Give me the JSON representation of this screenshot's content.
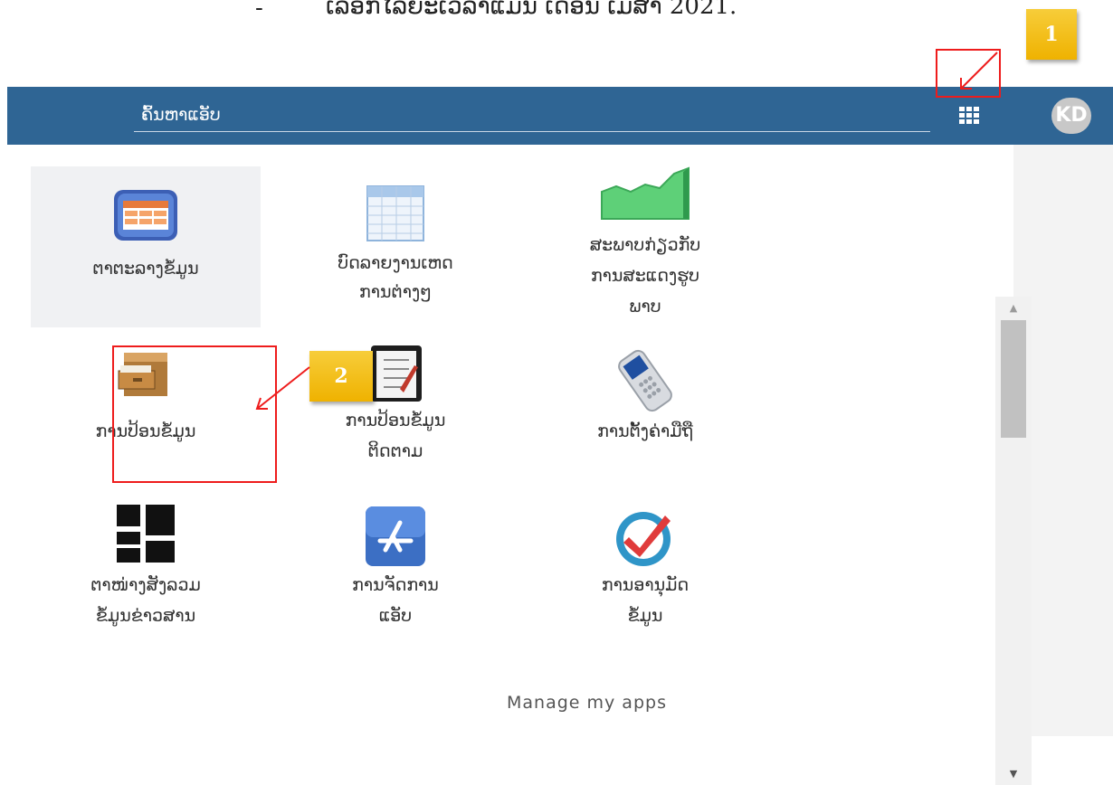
{
  "document_text": {
    "bullet": "-",
    "line": "ເລືອກໄລຍະເວລາແມ່ນ ເດືອນ ເມສາ 2021."
  },
  "topbar": {
    "search_placeholder": "ຄົ້ນຫາແອັບ",
    "avatar_initials": "KD"
  },
  "apps": [
    {
      "label_1": "ຕາຕະລາງຂໍ້ມູນ",
      "label_2": "",
      "label_3": "",
      "icon": "table-window-icon",
      "selected": true
    },
    {
      "label_1": "ບົດລາຍງານເຫດ",
      "label_2": "ການຕ່າງໆ",
      "label_3": "",
      "icon": "spreadsheet-icon",
      "selected": false
    },
    {
      "label_1": "ສະພາບກ່ຽວກັບ",
      "label_2": "ການສະແດງຮູບ",
      "label_3": "ພາບ",
      "icon": "area-chart-icon",
      "selected": false
    },
    {
      "label_1": "ການປ້ອນຂໍ້ມູນ",
      "label_2": "",
      "label_3": "",
      "icon": "file-cabinet-icon",
      "selected": false
    },
    {
      "label_1": "ການປ້ອນຂໍ້ມູນ",
      "label_2": "ຕິດຕາມ",
      "label_3": "",
      "icon": "clipboard-checklist-icon",
      "selected": false
    },
    {
      "label_1": "ການຕັ້ງຄ່າມືຖື",
      "label_2": "",
      "label_3": "",
      "icon": "mobile-phone-icon",
      "selected": false
    },
    {
      "label_1": "ຕາໜ່າງສັງລວມ",
      "label_2": "ຂໍ້ມູນຂ່າວສານ",
      "label_3": "",
      "icon": "dashboard-tiles-icon",
      "selected": false
    },
    {
      "label_1": "ການຈັດການ",
      "label_2": "ແອັບ",
      "label_3": "",
      "icon": "app-store-icon",
      "selected": false
    },
    {
      "label_1": "ການອານຸມັດ",
      "label_2": "ຂໍ້ມູນ",
      "label_3": "",
      "icon": "approval-check-icon",
      "selected": false
    }
  ],
  "footer": {
    "manage_apps": "Manage my apps"
  },
  "callouts": {
    "step1": "1",
    "step2": "2"
  },
  "colors": {
    "topbar": "#2f6594",
    "highlight_red": "#ee1c1c",
    "callout_yellow": "#f5c225"
  }
}
